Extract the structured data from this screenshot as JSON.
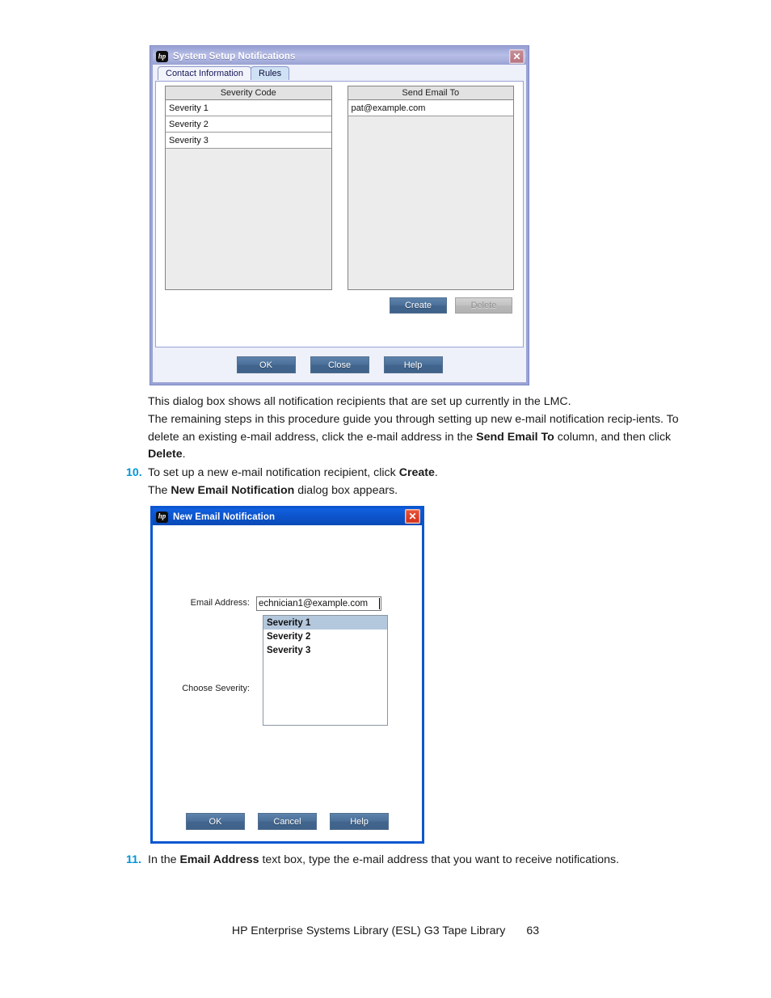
{
  "dialog1": {
    "title": "System Setup Notifications",
    "logo_icon": "hp-logo-icon",
    "close_icon": "close-icon",
    "tabs": [
      {
        "label": "Contact Information",
        "active": false
      },
      {
        "label": "Rules",
        "active": true
      }
    ],
    "severity_list": {
      "header": "Severity Code",
      "rows": [
        "Severity 1",
        "Severity 2",
        "Severity 3"
      ]
    },
    "email_list": {
      "header": "Send Email To",
      "rows": [
        "pat@example.com"
      ]
    },
    "actions": {
      "create_label": "Create",
      "delete_label": "Delete",
      "delete_disabled": true
    },
    "footer_buttons": {
      "ok_label": "OK",
      "close_label": "Close",
      "help_label": "Help"
    }
  },
  "dialog2": {
    "title": "New Email Notification",
    "logo_icon": "hp-logo-icon",
    "close_icon": "close-icon",
    "email_label": "Email Address:",
    "email_value": "echnician1@example.com",
    "choose_severity_label": "Choose Severity:",
    "severity_options": [
      "Severity 1",
      "Severity 2",
      "Severity 3"
    ],
    "severity_selected": "Severity 1",
    "footer_buttons": {
      "ok_label": "OK",
      "cancel_label": "Cancel",
      "help_label": "Help"
    }
  },
  "document": {
    "para1": "This dialog box shows all notification recipients that are set up currently in the LMC.",
    "para2_a": "The remaining steps in this procedure guide you through setting up new e-mail notification recip-ients. To delete an existing e-mail address, click the e-mail address in the ",
    "para2_bold1": "Send Email To",
    "para2_b": " column, and then click ",
    "para2_bold2": "Delete",
    "para2_c": ".",
    "step10_num": "10.",
    "step10_a": "To set up a new e-mail notification recipient, click ",
    "step10_bold": "Create",
    "step10_b": ".",
    "step10_sub_a": "The ",
    "step10_sub_bold": "New Email Notification",
    "step10_sub_b": " dialog box appears.",
    "step11_num": "11.",
    "step11_a": "In the ",
    "step11_bold": "Email Address",
    "step11_b": " text box, type the e-mail address that you want to receive notifications.",
    "footer_title": "HP Enterprise Systems Library (ESL) G3 Tape Library",
    "page_number": "63"
  },
  "colors": {
    "accent_blue": "#0096d6",
    "button_blue": "#4b7099",
    "active_titlebar": "#0c52c8",
    "inactive_titlebar": "#aab2de",
    "selection": "#b4c8dd"
  }
}
